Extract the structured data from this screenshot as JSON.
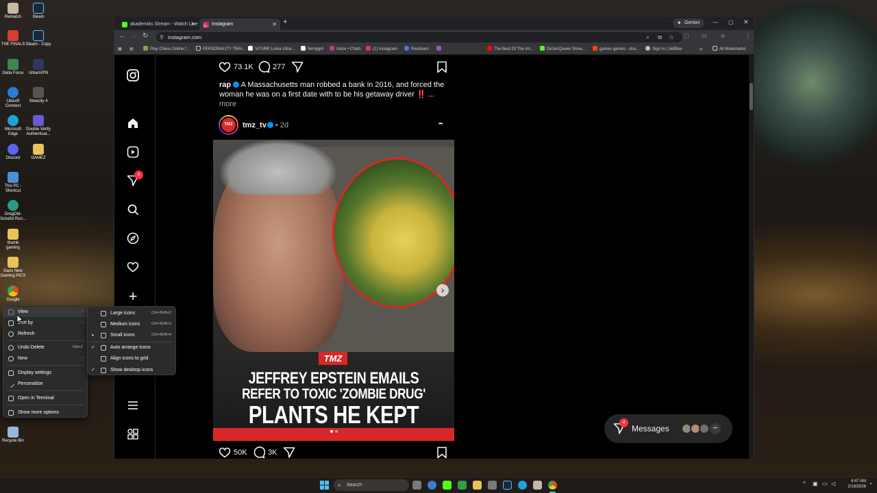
{
  "desktop": {
    "icons": [
      {
        "label": "Rematch",
        "color": "#c9b9a3"
      },
      {
        "label": "Steam",
        "color": "#1b2838"
      },
      {
        "label": "THE FINALS",
        "color": "#d4402c"
      },
      {
        "label": "Steam - Copy",
        "color": "#1b2838"
      },
      {
        "label": "Delta Force",
        "color": "#3b8a4c"
      },
      {
        "label": "UrbanVPN",
        "color": "#2b3a5c"
      },
      {
        "label": "Ubisoft Connect",
        "color": "#2a7bd6"
      },
      {
        "label": "Slowcity 4",
        "color": "#555555"
      },
      {
        "label": "Microsoft Edge",
        "color": "#1fa2d8"
      },
      {
        "label": "Double Verify Authenticat...",
        "color": "#6a5acd"
      },
      {
        "label": "Discord",
        "color": "#5865f2"
      },
      {
        "label": "GAMEZ",
        "color": "#e7c35a"
      },
      {
        "label": "This PC - Shortcut",
        "color": "#4a90d9"
      },
      {
        "label": "GregOld-Schefol Run...",
        "color": "#2b9a8a"
      },
      {
        "label": "thumb gaming",
        "color": "#e7c35a"
      },
      {
        "label": "Dans New Gaming PICS",
        "color": "#e7c35a"
      },
      {
        "label": "Google",
        "color": "#e94235"
      },
      {
        "label": "Recycle Bin",
        "color": "#9ab8d8"
      }
    ]
  },
  "browser": {
    "tabs": [
      {
        "label": "akademiks Stream - Watch Live",
        "color": "#53fc18"
      },
      {
        "label": "Instagram",
        "color": "#e1306c"
      }
    ],
    "new_tab": "+",
    "gemini_label": "Gemini",
    "url": "instagram.com",
    "bookmarks": [
      "Play Chess Online f...",
      "PERSONALITY TRAI...",
      "VITURE Luma Ultra...",
      "ferntygirl",
      "Inbox • Chats",
      "(1) Instagram",
      "Restream",
      "",
      "The Best Of The Int...",
      "DeJenQueen Strea...",
      "games games - sha...",
      "Sign In | JetBlue",
      "All Bookmarks"
    ]
  },
  "instagram": {
    "nav_badge": "4",
    "prev_post": {
      "likes": "73.1K",
      "comments": "277",
      "caption_user": "rap",
      "caption_text": "A Massachusetts man robbed a bank in 2016, and forced the woman he was on a first date with to be his getaway driver ‼️ ...",
      "more": "more"
    },
    "post": {
      "username": "tmz_tv",
      "avatar_text": "TMZ",
      "time": "• 2d",
      "menu": "•••",
      "image_logo": "TMZ",
      "headline_1": "JEFFREY EPSTEIN EMAILS",
      "headline_2": "REFER TO TOXIC 'ZOMBIE DRUG'",
      "headline_3": "PLANTS HE KEPT",
      "carousel_next": "›",
      "likes": "50K",
      "comments": "3K"
    },
    "messages": {
      "label": "Messages",
      "badge": "4",
      "more": "•••"
    }
  },
  "context_menu": {
    "items": [
      {
        "label": "View",
        "arrow": "›"
      },
      {
        "label": "Sort by",
        "arrow": "›"
      },
      {
        "label": "Refresh"
      },
      {
        "label": "Undo Delete",
        "shortcut": "Ctrl+Z"
      },
      {
        "label": "New",
        "arrow": "›"
      },
      {
        "label": "Display settings"
      },
      {
        "label": "Personalize"
      },
      {
        "label": "Open in Terminal"
      },
      {
        "label": "Show more options"
      }
    ],
    "submenu": [
      {
        "label": "Large icons",
        "shortcut": "Ctrl+Shift+2"
      },
      {
        "label": "Medium icons",
        "shortcut": "Ctrl+Shift+3"
      },
      {
        "label": "Small icons",
        "shortcut": "Ctrl+Shift+4",
        "checked": "•"
      },
      {
        "label": "Auto arrange icons",
        "checked": "✓"
      },
      {
        "label": "Align icons to grid"
      },
      {
        "label": "Show desktop icons",
        "checked": "✓"
      }
    ]
  },
  "taskbar": {
    "search_placeholder": "Search",
    "time": "4:47 AM",
    "date": "2/19/2026"
  }
}
